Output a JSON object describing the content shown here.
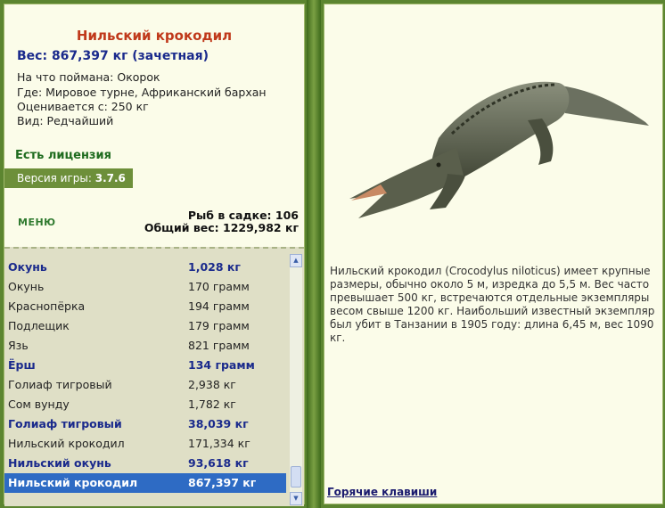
{
  "catch": {
    "title": "Нильский крокодил",
    "weight": "Вес: 867,397 кг (зачетная)",
    "caught_on": "На что поймана: Окорок",
    "location": "Где: Мировое турне, Африканский бархан",
    "valued_from": "Оценивается с: 250 кг",
    "rarity": "Вид: Редчайший"
  },
  "license": "Есть лицензия",
  "version": {
    "label": "Версия игры:",
    "value": "3.7.6"
  },
  "menu_label": "МЕНЮ",
  "stats": {
    "fish_in_keepnet": "Рыб в садке: 106",
    "total_weight": "Общий вес: 1229,982 кг"
  },
  "fish_list": [
    {
      "name": "Окунь",
      "weight": "1,028 кг",
      "bold": true
    },
    {
      "name": "Окунь",
      "weight": "170 грамм",
      "bold": false
    },
    {
      "name": "Краснопёрка",
      "weight": "194 грамм",
      "bold": false
    },
    {
      "name": "Подлещик",
      "weight": "179 грамм",
      "bold": false
    },
    {
      "name": "Язь",
      "weight": "821 грамм",
      "bold": false
    },
    {
      "name": "Ёрш",
      "weight": "134 грамм",
      "bold": true
    },
    {
      "name": "Голиаф тигровый",
      "weight": "2,938 кг",
      "bold": false
    },
    {
      "name": "Сом вунду",
      "weight": "1,782 кг",
      "bold": false
    },
    {
      "name": "Голиаф тигровый",
      "weight": "38,039 кг",
      "bold": true
    },
    {
      "name": "Нильский крокодил",
      "weight": "171,334 кг",
      "bold": false
    },
    {
      "name": "Нильский окунь",
      "weight": "93,618 кг",
      "bold": true
    },
    {
      "name": "Нильский крокодил",
      "weight": "867,397 кг",
      "bold": true,
      "selected": true
    }
  ],
  "description": "Нильский крокодил (Crocodylus niloticus) имеет крупные размеры, обычно около 5 м, изредка до 5,5 м. Вес часто превышает 500 кг, встречаются отдельные экземпляры весом свыше 1200 кг. Наибольший известный экземпляр был убит в Танзании в 1905 году: длина 6,45 м, вес 1090 кг.",
  "hotkeys_link": "Горячие клавиши",
  "colors": {
    "frame": "#5c8530",
    "panel": "#fbfce9",
    "selection": "#2e6bc4",
    "rare_text": "#1a2a8c",
    "title": "#c0391b"
  }
}
